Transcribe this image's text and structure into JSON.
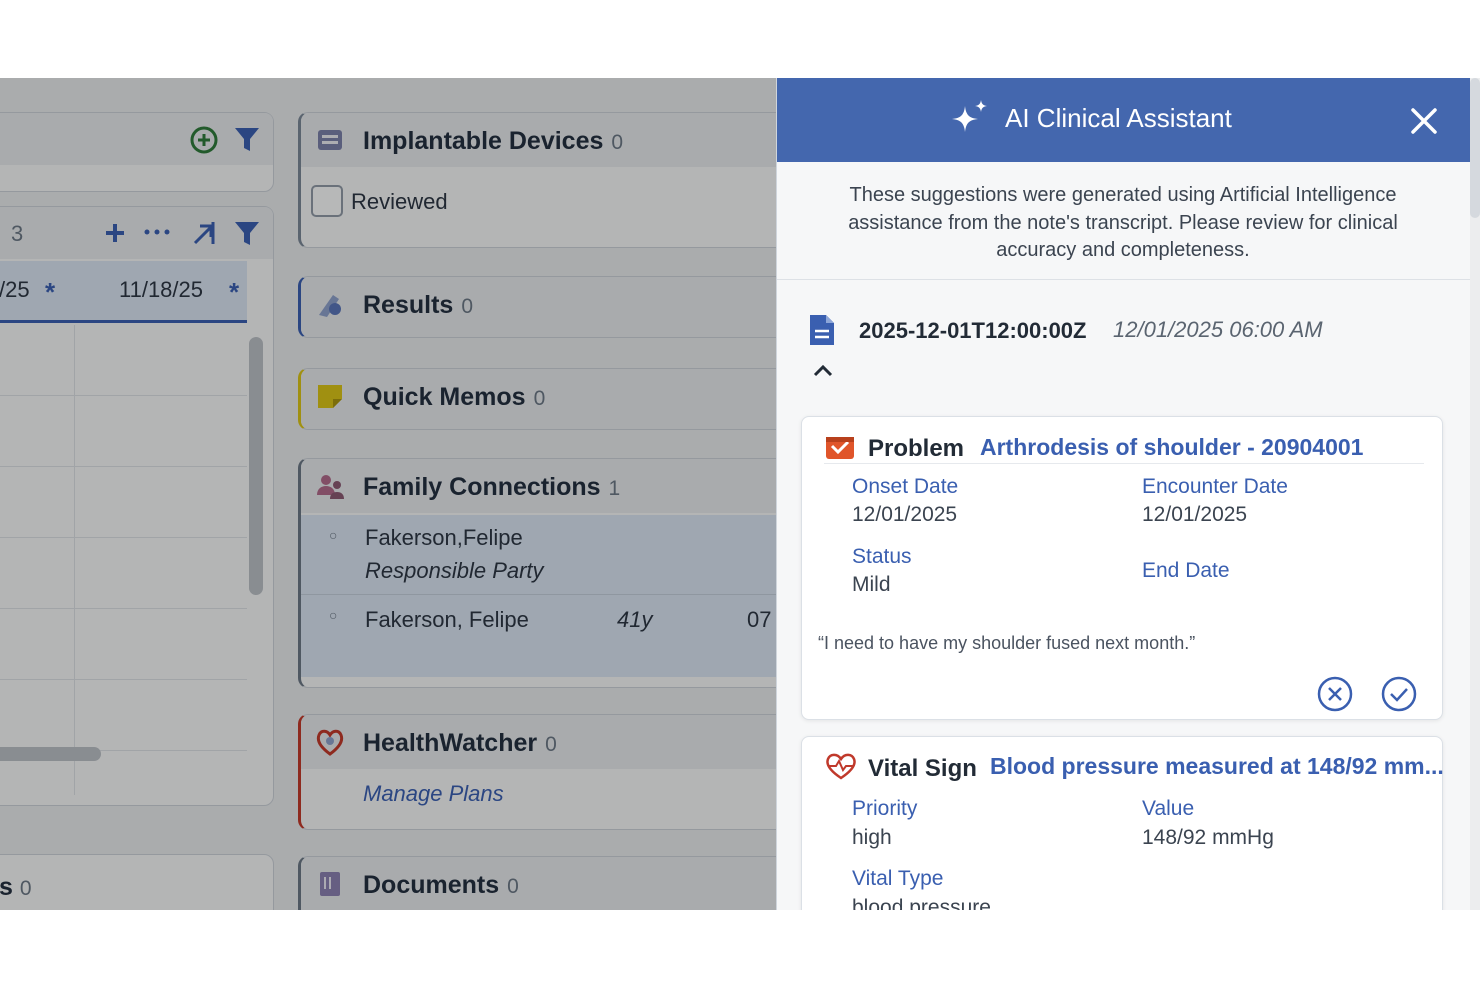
{
  "background": {
    "left_column": {
      "count_label": "3",
      "dates": [
        "/25",
        "11/18/25"
      ],
      "bottom_count_prefix": "s",
      "bottom_count": "0"
    },
    "cards": {
      "implantable_devices": {
        "title": "Implantable Devices",
        "count": "0",
        "checkbox_label": "Reviewed"
      },
      "results": {
        "title": "Results",
        "count": "0"
      },
      "quick_memos": {
        "title": "Quick Memos",
        "count": "0"
      },
      "family_connections": {
        "title": "Family Connections",
        "count": "1",
        "rows": [
          {
            "name": "Fakerson,Felipe",
            "role": "Responsible Party"
          },
          {
            "name": "Fakerson, Felipe",
            "age": "41y",
            "extra": "07"
          }
        ]
      },
      "healthwatcher": {
        "title": "HealthWatcher",
        "count": "0",
        "link": "Manage Plans"
      },
      "documents": {
        "title": "Documents",
        "count": "0"
      }
    }
  },
  "panel": {
    "title": "AI Clinical Assistant",
    "disclaimer": "These suggestions were generated using Artificial Intelligence assistance from the note's transcript. Please review for clinical accuracy and completeness.",
    "note": {
      "id": "2025-12-01T12:00:00Z",
      "datetime": "12/01/2025 06:00 AM"
    },
    "suggestions": [
      {
        "type": "Problem",
        "name": "Arthrodesis of shoulder - 20904001",
        "fields": {
          "onset_label": "Onset Date",
          "onset_value": "12/01/2025",
          "encounter_label": "Encounter Date",
          "encounter_value": "12/01/2025",
          "status_label": "Status",
          "status_value": "Mild",
          "end_label": "End Date"
        },
        "quote": "“I need to have my shoulder fused next month.”"
      },
      {
        "type": "Vital Sign",
        "name": "Blood pressure measured at 148/92 mm...",
        "fields": {
          "priority_label": "Priority",
          "priority_value": "high",
          "value_label": "Value",
          "value_value": "148/92 mmHg",
          "vitaltype_label": "Vital Type",
          "vitaltype_value": "blood pressure"
        }
      }
    ]
  },
  "colors": {
    "panel_header": "#4467ae",
    "link_blue": "#3a5fb0",
    "problem_icon": "#e0552a",
    "vital_icon": "#c0392b",
    "memo_yellow": "#d8c318",
    "health_red": "#c0392b"
  },
  "icons": [
    "add-circle-icon",
    "filter-icon",
    "plus-icon",
    "more-icon",
    "expand-icon",
    "device-icon",
    "results-icon",
    "memo-icon",
    "family-icon",
    "heart-icon",
    "documents-icon",
    "sparkle-icon",
    "close-icon",
    "document-icon",
    "chevron-up-icon",
    "problem-icon",
    "vital-sign-icon",
    "reject-icon",
    "accept-icon"
  ]
}
